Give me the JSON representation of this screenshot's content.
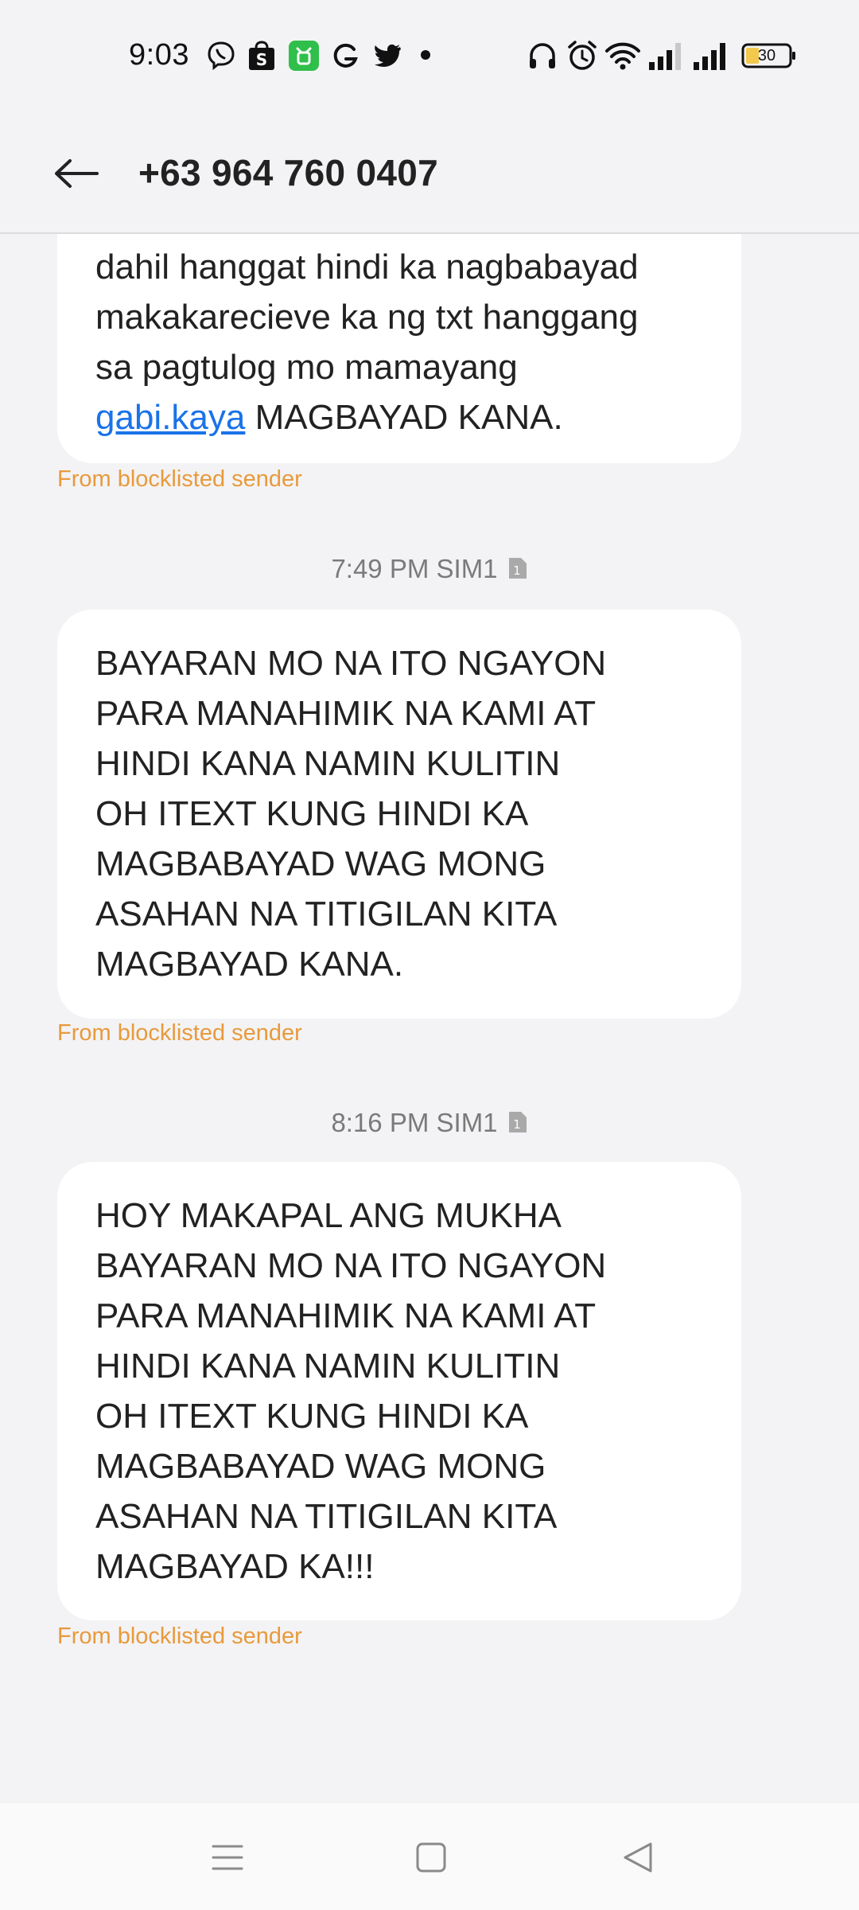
{
  "status_bar": {
    "time": "9:03",
    "battery_level": "30",
    "left_icons": [
      "viber-icon",
      "shopee-icon",
      "app-icon",
      "grammarly-icon",
      "twitter-icon",
      "dot-icon"
    ],
    "right_icons": [
      "headphones-icon",
      "alarm-icon",
      "wifi-icon",
      "signal-icon",
      "signal-icon",
      "battery-icon"
    ]
  },
  "header": {
    "title": "+63 964 760 0407",
    "back_icon": "arrow-left-icon"
  },
  "messages": [
    {
      "text_before": "dahil hanggat hindi ka nagbabayad\nmakakarecieve ka ng txt hanggang\nsa pagtulog mo mamayang\n",
      "link": "gabi.kaya",
      "text_after": " MAGBAYAD KANA.",
      "note": "From blocklisted sender"
    },
    {
      "timestamp": "7:49 PM",
      "sim": "SIM1",
      "text": " BAYARAN MO NA ITO NGAYON\nPARA MANAHIMIK NA KAMI AT\nHINDI KANA NAMIN KULITIN\nOH ITEXT KUNG HINDI KA\nMAGBABAYAD WAG MONG\nASAHAN NA TITIGILAN KITA\nMAGBAYAD KANA.",
      "note": "From blocklisted sender"
    },
    {
      "timestamp": "8:16 PM",
      "sim": "SIM1",
      "text": "HOY MAKAPAL ANG MUKHA\nBAYARAN MO NA ITO NGAYON\nPARA MANAHIMIK NA KAMI AT\nHINDI KANA NAMIN KULITIN\nOH ITEXT KUNG HINDI KA\nMAGBABAYAD WAG MONG\nASAHAN NA TITIGILAN KITA\nMAGBAYAD KA!!!",
      "note": "From blocklisted sender"
    }
  ],
  "nav_bar": {
    "icons": [
      "menu-icon",
      "home-icon",
      "back-triangle-icon"
    ]
  },
  "colors": {
    "background": "#f3f3f5",
    "bubble": "#ffffff",
    "link": "#1a73e8",
    "blocklist_note": "#e89a3c"
  }
}
